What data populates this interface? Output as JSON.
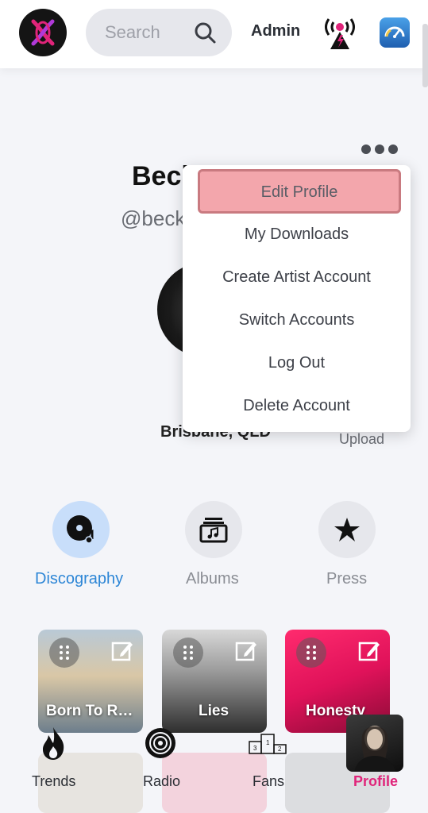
{
  "header": {
    "search_placeholder": "Search",
    "admin_label": "Admin",
    "logo_icon": "x-logo-icon",
    "radio_icon": "radio-tower-icon",
    "speed_icon": "speedometer-icon"
  },
  "profile": {
    "name": "Becky Harris",
    "handle": "@beckyharris",
    "location": "Brisbane, QLD",
    "upload_label": "Upload"
  },
  "menu": {
    "items": [
      {
        "label": "Edit Profile"
      },
      {
        "label": "My Downloads"
      },
      {
        "label": "Create Artist Account"
      },
      {
        "label": "Switch Accounts"
      },
      {
        "label": "Log Out"
      },
      {
        "label": "Delete Account"
      }
    ]
  },
  "tabs": [
    {
      "label": "Discography",
      "icon": "vinyl-disc-icon",
      "active": true
    },
    {
      "label": "Albums",
      "icon": "album-stack-icon",
      "active": false
    },
    {
      "label": "Press",
      "icon": "star-icon",
      "active": false
    }
  ],
  "releases": [
    {
      "title": "Born To R…"
    },
    {
      "title": "Lies"
    },
    {
      "title": "Honesty"
    }
  ],
  "bottom_nav": [
    {
      "label": "Trends",
      "icon": "flame-icon"
    },
    {
      "label": "Radio",
      "icon": "radio-broadcast-icon"
    },
    {
      "label": "Fans",
      "icon": "podium-icon"
    },
    {
      "label": "Profile",
      "icon": "profile-thumbnail",
      "active": true
    }
  ],
  "colors": {
    "accent": "#e0247a",
    "tab_active": "#2d86d6",
    "menu_highlight": "#f3a6ac"
  }
}
